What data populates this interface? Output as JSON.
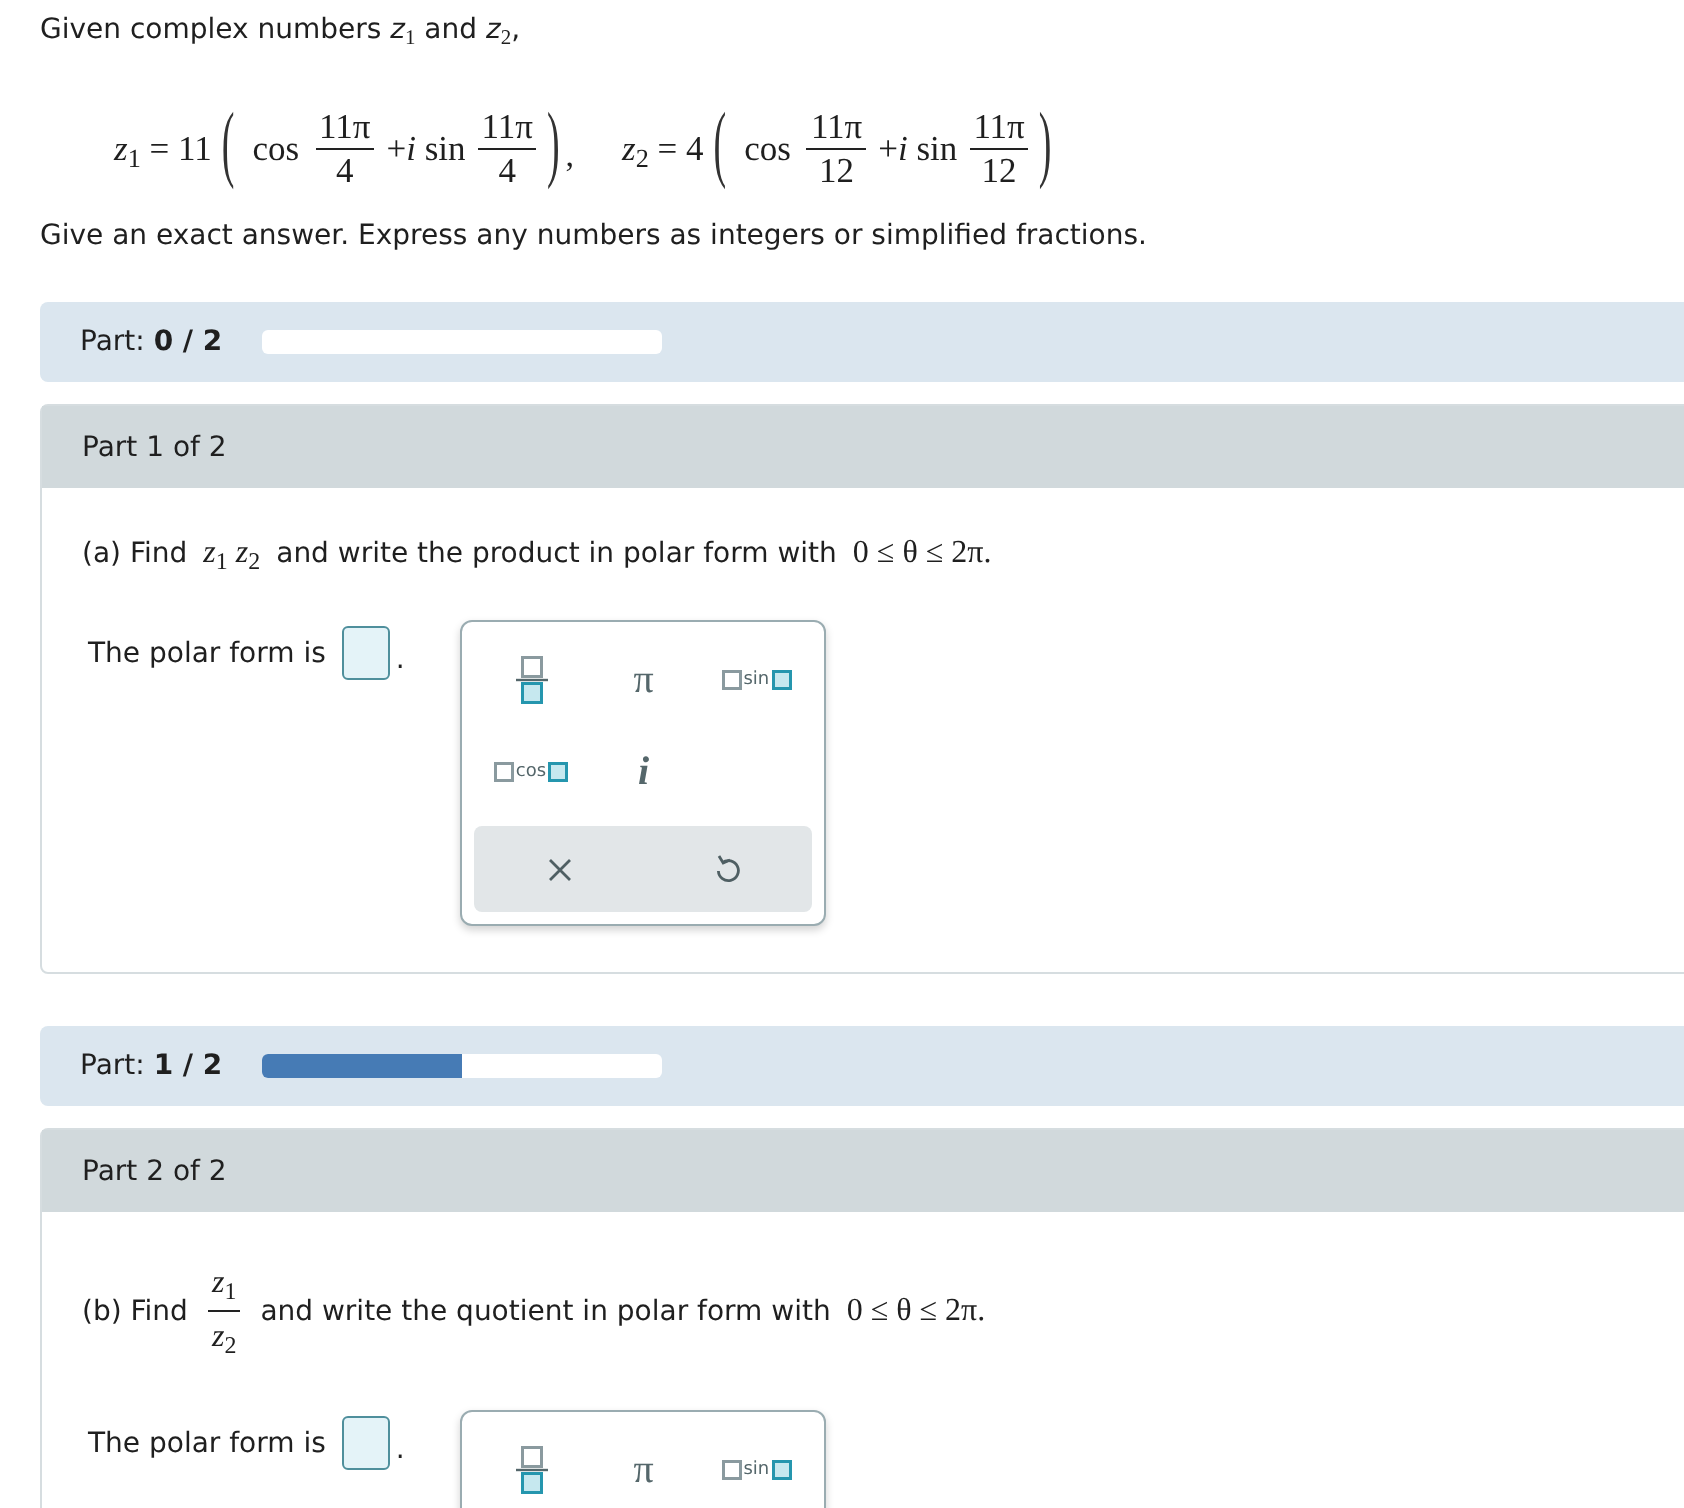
{
  "intro": "Given complex numbers *z*$_{1}$ and *z*$_{2}$,",
  "formulas": [
    {
      "lhs": "*z*$_{1}$ = 11",
      "open": "(",
      "terms": [
        {
          "operator": "cos",
          "numerator": "11π",
          "denominator": "4"
        },
        {
          "operator": "+*i* sin",
          "numerator": "11π",
          "denominator": "4"
        }
      ],
      "close": ")",
      "separator": ","
    },
    {
      "lhs": "*z*$_{2}$ = 4",
      "open": "(",
      "terms": [
        {
          "operator": "cos",
          "numerator": "11π",
          "denominator": "12"
        },
        {
          "operator": "+*i* sin",
          "numerator": "11π",
          "denominator": "12"
        }
      ],
      "close": ")"
    }
  ],
  "instructions": "Give an exact answer. Express any numbers as integers or simplified fractions.",
  "parts": [
    {
      "progress": {
        "label": "Part: **0 / 2**"
      },
      "title": "Part 1 of 2",
      "question": [
        {
          "kind": "text",
          "text": "(a) Find"
        },
        {
          "kind": "math",
          "text": "*z*$_{1}$ *z*$_{2}$"
        },
        {
          "kind": "text",
          "text": "and write the product in polar form with"
        },
        {
          "kind": "math",
          "text": "0 ≤ θ ≤ 2π."
        }
      ],
      "answer": {
        "label": "The polar form is",
        "suffix": "."
      },
      "keypad": {
        "keys": [
          {
            "kind": "fraction"
          },
          {
            "kind": "symbol",
            "text": "π"
          },
          {
            "kind": "function",
            "text": "sin"
          },
          {
            "kind": "function",
            "text": "cos"
          },
          {
            "kind": "variable",
            "text": "i"
          }
        ],
        "actions": [
          {
            "kind": "clear"
          },
          {
            "kind": "undo"
          }
        ]
      }
    },
    {
      "progress": {
        "label": "Part: **1 / 2**",
        "level": 0.5
      },
      "title": "Part 2 of 2",
      "question": [
        {
          "kind": "text",
          "text": "(b) Find"
        },
        {
          "kind": "fraction",
          "numerator": "*z*$_{1}$",
          "denominator": "*z*$_{2}$"
        },
        {
          "kind": "text",
          "text": "and write the quotient in polar form with"
        },
        {
          "kind": "math",
          "text": "0 ≤ θ ≤ 2π."
        }
      ],
      "answer": {
        "label": "The polar form is",
        "suffix": "."
      },
      "keypad": {
        "keys": [
          {
            "kind": "fraction"
          },
          {
            "kind": "symbol",
            "text": "π"
          },
          {
            "kind": "function",
            "text": "sin"
          }
        ]
      }
    }
  ]
}
